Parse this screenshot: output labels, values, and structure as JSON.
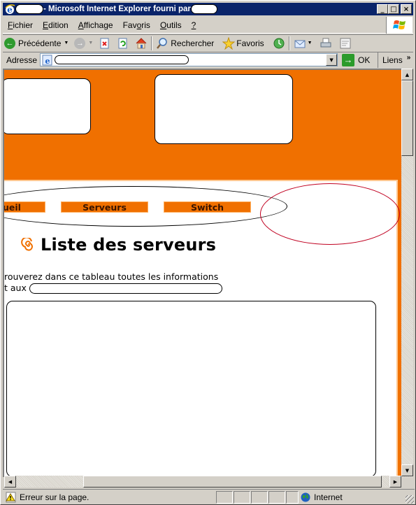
{
  "window": {
    "title": "- Microsoft Internet Explorer fourni par",
    "controls": {
      "minimize": "_",
      "maximize": "□",
      "close": "×"
    }
  },
  "menubar": {
    "items": [
      {
        "label": "Fichier",
        "accel": "F"
      },
      {
        "label": "Edition",
        "accel": "E"
      },
      {
        "label": "Affichage",
        "accel": "A"
      },
      {
        "label": "Favoris",
        "accel": "o"
      },
      {
        "label": "Outils",
        "accel": "O"
      },
      {
        "label": "?",
        "accel": "?"
      }
    ]
  },
  "toolbar": {
    "back_label": "Précédente",
    "search_label": "Rechercher",
    "favorites_label": "Favoris"
  },
  "addressbar": {
    "label": "Adresse",
    "go_label": "OK",
    "links_label": "Liens",
    "links_chevron": "»"
  },
  "page": {
    "nav": [
      {
        "label": "ueil"
      },
      {
        "label": "Serveurs"
      },
      {
        "label": "Switch"
      }
    ],
    "title": "Liste des serveurs",
    "intro_line1": "rouverez dans ce tableau toutes les informations",
    "intro_line2": "t aux",
    "colors": {
      "accent": "#f07000",
      "accent_light": "#ffc890",
      "annotation_black": "#000000",
      "annotation_red": "#c00020"
    }
  },
  "statusbar": {
    "message": "Erreur sur la page.",
    "zone": "Internet"
  }
}
